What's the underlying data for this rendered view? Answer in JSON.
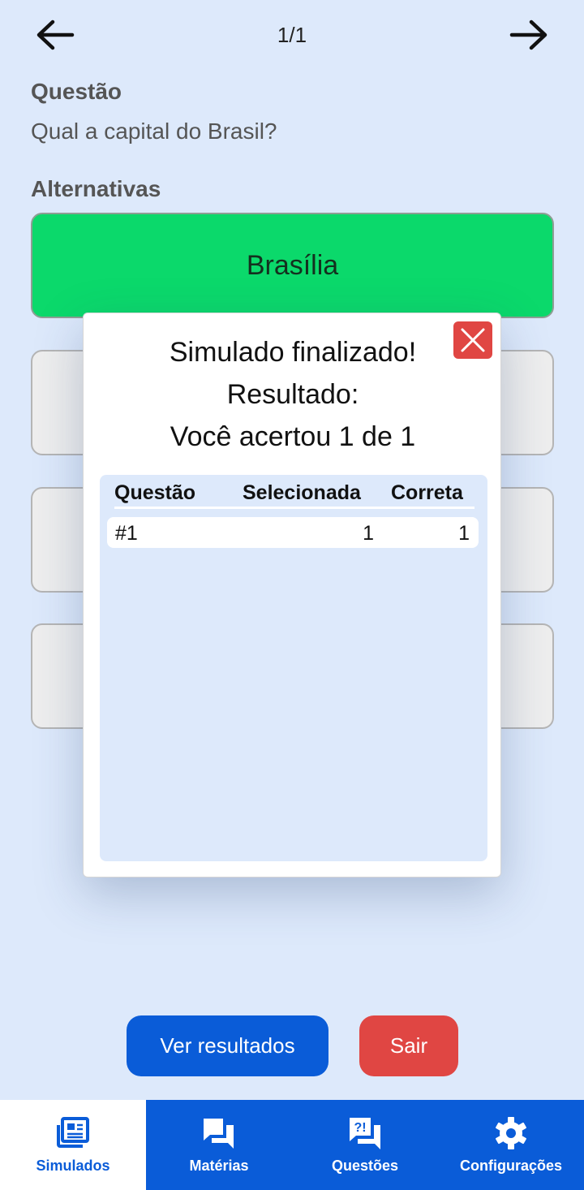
{
  "header": {
    "counter": "1/1",
    "back_icon": "arrow-left-icon",
    "forward_icon": "arrow-right-icon"
  },
  "question": {
    "label": "Questão",
    "text": "Qual a capital do Brasil?"
  },
  "alternatives": {
    "label": "Alternativas",
    "items": [
      {
        "text": "Brasília",
        "state": "correct"
      },
      {
        "text": "",
        "state": "default"
      },
      {
        "text": "",
        "state": "default"
      },
      {
        "text": "",
        "state": "default"
      }
    ]
  },
  "modal": {
    "title": "Simulado finalizado!",
    "subtitle": "Resultado:",
    "score_text": "Você acertou 1 de 1",
    "close_icon": "close-icon",
    "table": {
      "columns": [
        "Questão",
        "Selecionada",
        "Correta"
      ],
      "rows": [
        {
          "question": "#1",
          "selected": "1",
          "correct": "1"
        }
      ]
    }
  },
  "actions": {
    "view_results": "Ver resultados",
    "exit": "Sair"
  },
  "bottom_nav": {
    "items": [
      {
        "label": "Simulados",
        "icon": "newspaper-icon",
        "active": true
      },
      {
        "label": "Matérias",
        "icon": "chat-bubbles-icon",
        "active": false
      },
      {
        "label": "Questões",
        "icon": "question-chat-icon",
        "active": false
      },
      {
        "label": "Configurações",
        "icon": "gear-icon",
        "active": false
      }
    ]
  },
  "colors": {
    "background": "#dde9fb",
    "primary": "#0a5cd8",
    "correct": "#0bd96b",
    "danger": "#e04643"
  }
}
